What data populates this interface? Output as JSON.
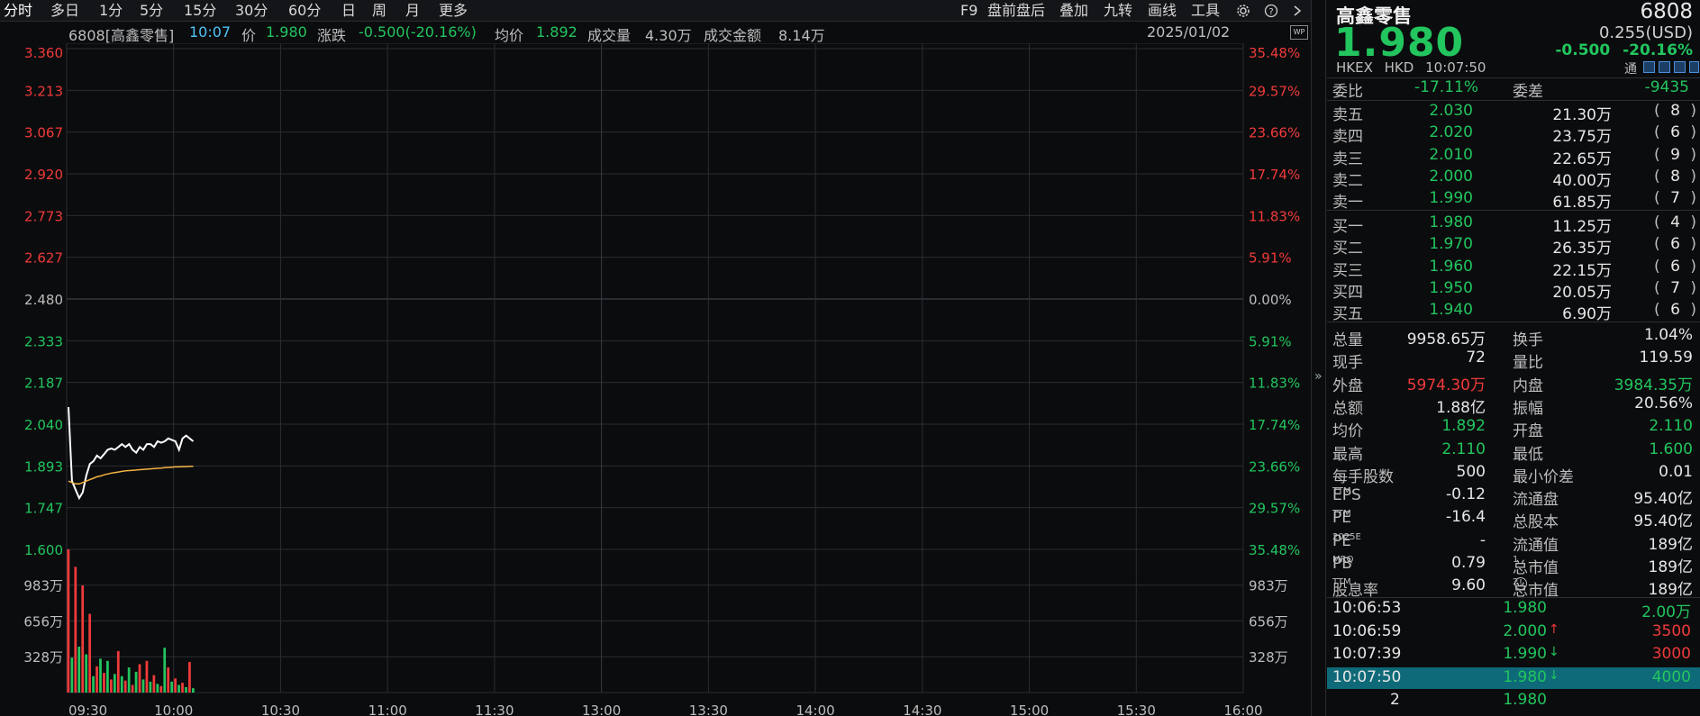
{
  "toolbar": {
    "tabs": [
      "分时",
      "多日",
      "1分",
      "5分",
      "15分",
      "30分",
      "60分",
      "日",
      "周",
      "月",
      "更多"
    ],
    "right_items": [
      "F9",
      "盘前盘后",
      "叠加",
      "九转",
      "画线",
      "工具"
    ],
    "icons": [
      "gear-icon",
      "help-icon",
      "chevron-right-icon"
    ]
  },
  "infobar": {
    "code_name": "6808[高鑫零售]",
    "time": "10:07",
    "price_label": "价",
    "price": "1.980",
    "change_label": "涨跌",
    "change": "-0.500(-20.16%)",
    "avg_label": "均价",
    "avg": "1.892",
    "vol_label": "成交量",
    "vol": "4.30万",
    "amount_label": "成交金额",
    "amount": "8.14万",
    "date": "2025/01/02",
    "wp_badge": "WP"
  },
  "chart_data": {
    "type": "line",
    "title": "",
    "price_axis": {
      "ticks": [
        "3.360",
        "3.213",
        "3.067",
        "2.920",
        "2.773",
        "2.627",
        "2.480",
        "2.333",
        "2.187",
        "2.040",
        "1.893",
        "1.747",
        "1.600"
      ],
      "pct_ticks": [
        "35.48%",
        "29.57%",
        "23.66%",
        "17.74%",
        "11.83%",
        "5.91%",
        "0.00%",
        "5.91%",
        "11.83%",
        "17.74%",
        "23.66%",
        "29.57%",
        "35.48%"
      ],
      "ylim": [
        1.6,
        3.36
      ],
      "prev_close": 2.48
    },
    "volume_axis": {
      "ticks": [
        "983万",
        "656万",
        "328万"
      ],
      "ylim": [
        0,
        13100000
      ]
    },
    "x_ticks": [
      "09:30",
      "10:00",
      "10:30",
      "11:00",
      "11:30",
      "13:00",
      "13:30",
      "14:00",
      "14:30",
      "15:00",
      "15:30",
      "16:00"
    ],
    "series": [
      {
        "name": "",
        "color": "#ffffff",
        "values": [
          2.1,
          1.84,
          1.81,
          1.78,
          1.8,
          1.86,
          1.9,
          1.91,
          1.93,
          1.92,
          1.935,
          1.95,
          1.955,
          1.95,
          1.96,
          1.97,
          1.96,
          1.97,
          1.95,
          1.94,
          1.96,
          1.95,
          1.97,
          1.97,
          1.96,
          1.98,
          1.975,
          1.98,
          1.99,
          1.985,
          1.98,
          1.95,
          1.99,
          2.0,
          1.99,
          1.98
        ]
      },
      {
        "name": "",
        "color": "#f5b342",
        "values": [
          1.84,
          1.835,
          1.83,
          1.83,
          1.835,
          1.84,
          1.845,
          1.85,
          1.855,
          1.858,
          1.862,
          1.865,
          1.868,
          1.87,
          1.872,
          1.874,
          1.876,
          1.877,
          1.878,
          1.879,
          1.88,
          1.881,
          1.882,
          1.883,
          1.884,
          1.885,
          1.886,
          1.887,
          1.888,
          1.889,
          1.89,
          1.89,
          1.891,
          1.891,
          1.892,
          1.892
        ]
      }
    ],
    "volumes": [
      13100000,
      3200000,
      11500000,
      4200000,
      9800000,
      3500000,
      7200000,
      1500000,
      2400000,
      3100000,
      1800000,
      2900000,
      1200000,
      1700000,
      3800000,
      1500000,
      1100000,
      2300000,
      700000,
      1900000,
      2600000,
      1200000,
      2900000,
      1000000,
      1600000,
      800000,
      600000,
      4100000,
      2300000,
      1000000,
      1300000,
      700000,
      900000,
      500000,
      2800000,
      400000
    ],
    "volume_colors": [
      "up",
      "down",
      "up",
      "down",
      "up",
      "down",
      "up",
      "down",
      "up",
      "down",
      "up",
      "down",
      "up",
      "down",
      "up",
      "down",
      "up",
      "down",
      "up",
      "down",
      "up",
      "down",
      "up",
      "down",
      "up",
      "down",
      "up",
      "down",
      "up",
      "down",
      "up",
      "down",
      "up",
      "down",
      "up",
      "down"
    ],
    "colors": {
      "up": "#ef3a3a",
      "down": "#22c55e",
      "grid": "#2a2d33",
      "axis_up": "#ef3a3a",
      "axis_down": "#22c55e",
      "axis_flat": "#bdbdbd"
    }
  },
  "panel": {
    "name": "高鑫零售",
    "code": "6808",
    "price": "1.980",
    "usd": "0.255(USD)",
    "change": "-0.500",
    "change_pct": "-20.16%",
    "exchange": "HKEX",
    "currency": "HKD",
    "time": "10:07:50",
    "tong": "通",
    "weibi_label": "委比",
    "weibi": "-17.11%",
    "weicha_label": "委差",
    "weicha": "-9435",
    "sells": [
      {
        "label": "卖五",
        "price": "2.030",
        "vol": "21.30万",
        "count": "8"
      },
      {
        "label": "卖四",
        "price": "2.020",
        "vol": "23.75万",
        "count": "6"
      },
      {
        "label": "卖三",
        "price": "2.010",
        "vol": "22.65万",
        "count": "9"
      },
      {
        "label": "卖二",
        "price": "2.000",
        "vol": "40.00万",
        "count": "8"
      },
      {
        "label": "卖一",
        "price": "1.990",
        "vol": "61.85万",
        "count": "7"
      }
    ],
    "buys": [
      {
        "label": "买一",
        "price": "1.980",
        "vol": "11.25万",
        "count": "4"
      },
      {
        "label": "买二",
        "price": "1.970",
        "vol": "26.35万",
        "count": "6"
      },
      {
        "label": "买三",
        "price": "1.960",
        "vol": "22.15万",
        "count": "6"
      },
      {
        "label": "买四",
        "price": "1.950",
        "vol": "20.05万",
        "count": "7"
      },
      {
        "label": "买五",
        "price": "1.940",
        "vol": "6.90万",
        "count": "6"
      }
    ],
    "stats": [
      {
        "l1": "总量",
        "v1": "9958.65万",
        "c1": "white",
        "l2": "换手",
        "v2": "1.04%",
        "c2": "white"
      },
      {
        "l1": "现手",
        "v1": "72",
        "c1": "white",
        "l2": "量比",
        "v2": "119.59",
        "c2": "white"
      },
      {
        "l1": "外盘",
        "v1": "5974.30万",
        "c1": "red",
        "l2": "内盘",
        "v2": "3984.35万",
        "c2": "green"
      },
      {
        "l1": "总额",
        "v1": "1.88亿",
        "c1": "white",
        "l2": "振幅",
        "v2": "20.56%",
        "c2": "white"
      },
      {
        "l1": "均价",
        "v1": "1.892",
        "c1": "green",
        "l2": "开盘",
        "v2": "2.110",
        "c2": "green"
      },
      {
        "l1": "最高",
        "v1": "2.110",
        "c1": "green",
        "l2": "最低",
        "v2": "1.600",
        "c2": "green"
      },
      {
        "l1": "每手股数",
        "v1": "500",
        "c1": "white",
        "l2": "最小价差",
        "v2": "0.01",
        "c2": "white"
      },
      {
        "l1": "EPS",
        "s1": "TTM",
        "v1": "-0.12",
        "c1": "white",
        "l2": "流通盘",
        "v2": "95.40亿",
        "c2": "white"
      },
      {
        "l1": "PE",
        "s1": "TTM",
        "v1": "-16.4",
        "c1": "white",
        "l2": "总股本",
        "v2": "95.40亿",
        "c2": "white"
      },
      {
        "l1": "PE",
        "s1": "2025E",
        "v1": "-",
        "c1": "white",
        "l2": "流通值",
        "v2": "189亿",
        "c2": "white"
      },
      {
        "l1": "PB",
        "s1": "MRQ",
        "v1": "0.79",
        "c1": "white",
        "l2": "总市值",
        "s2": "1",
        "v2": "189亿",
        "c2": "white"
      },
      {
        "l1": "股息率",
        "s1": "TTM",
        "v1": "9.60",
        "c1": "white",
        "l2": "总市值",
        "s2": "2",
        "v2": "189亿",
        "c2": "white"
      }
    ],
    "ticks": [
      {
        "time": "10:06:53",
        "price": "1.980",
        "arrow": "",
        "vol": "2.00万",
        "vc": "green",
        "sel": false
      },
      {
        "time": "10:06:59",
        "price": "2.000",
        "arrow": "↑",
        "vol": "3500",
        "vc": "red",
        "sel": false
      },
      {
        "time": "10:07:39",
        "price": "1.990",
        "arrow": "↓",
        "vol": "3000",
        "vc": "red",
        "sel": false
      },
      {
        "time": "10:07:50",
        "price": "1.980",
        "arrow": "↓",
        "vol": "4000",
        "vc": "green",
        "sel": true
      },
      {
        "time": "2",
        "price": "1.980",
        "arrow": "",
        "vol": "",
        "vc": "green",
        "sel": false
      }
    ]
  }
}
